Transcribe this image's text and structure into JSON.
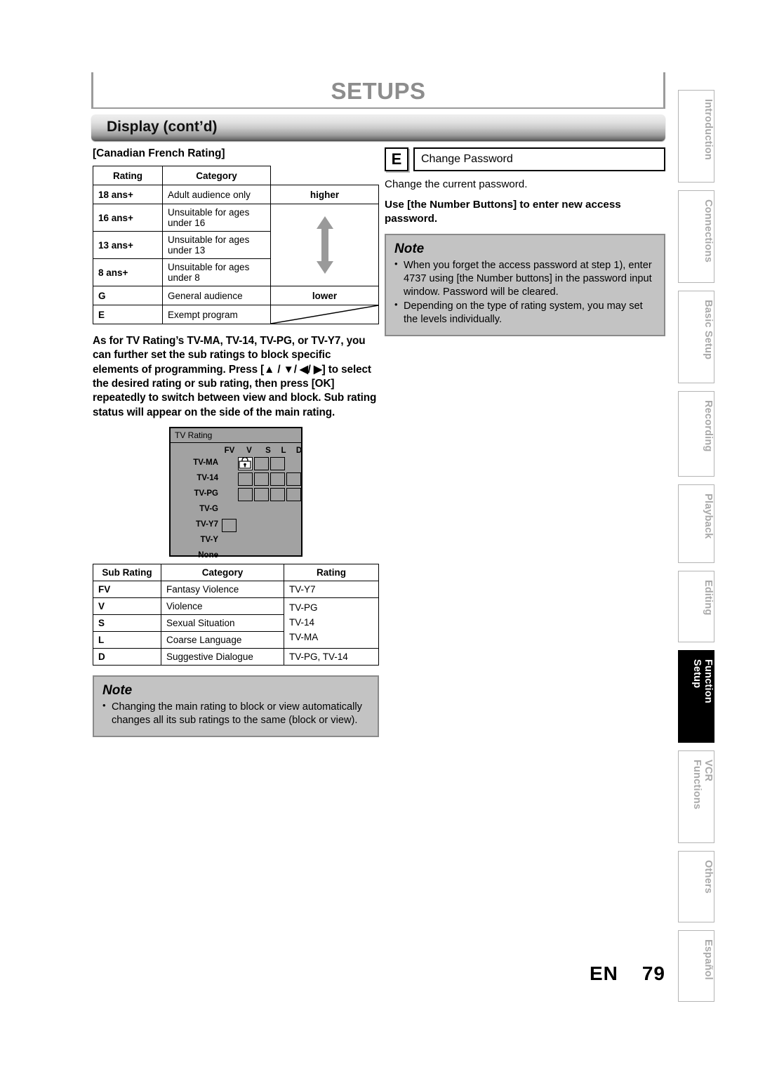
{
  "header": {
    "title": "SETUPS",
    "section_title": "Display (cont’d)"
  },
  "left": {
    "canadian_heading": "[Canadian French Rating]",
    "cf_table": {
      "columns": [
        "Rating",
        "Category"
      ],
      "rows": [
        {
          "rating": "18 ans+",
          "category": "Adult audience only"
        },
        {
          "rating": "16 ans+",
          "category": "Unsuitable for ages under 16"
        },
        {
          "rating": "13 ans+",
          "category": "Unsuitable for ages under 13"
        },
        {
          "rating": "8 ans+",
          "category": "Unsuitable for ages under 8"
        },
        {
          "rating": "G",
          "category": "General audience"
        },
        {
          "rating": "E",
          "category": "Exempt program"
        }
      ],
      "scale_top": "higher",
      "scale_bottom": "lower"
    },
    "instruction": "As for TV Rating’s TV-MA, TV-14, TV-PG, or TV-Y7, you can further set the sub ratings to block specific elements of programming. Press [▲ / ▼/ ◀/ ▶] to select the desired rating or sub rating, then press [OK] repeatedly to switch between view and block. Sub rating status will appear on the side of the main rating.",
    "osd": {
      "title": "TV Rating",
      "columns": [
        "FV",
        "V",
        "S",
        "L",
        "D"
      ],
      "rows": [
        "TV-MA",
        "TV-14",
        "TV-PG",
        "TV-G",
        "TV-Y7",
        "TV-Y",
        "None"
      ],
      "cells": [
        {
          "row": "TV-MA",
          "col": "V",
          "state": "blocked",
          "icon": "lock-icon"
        },
        {
          "row": "TV-MA",
          "col": "S",
          "state": "view"
        },
        {
          "row": "TV-MA",
          "col": "L",
          "state": "view"
        },
        {
          "row": "TV-14",
          "col": "V",
          "state": "view"
        },
        {
          "row": "TV-14",
          "col": "S",
          "state": "view"
        },
        {
          "row": "TV-14",
          "col": "L",
          "state": "view"
        },
        {
          "row": "TV-14",
          "col": "D",
          "state": "view"
        },
        {
          "row": "TV-PG",
          "col": "V",
          "state": "view"
        },
        {
          "row": "TV-PG",
          "col": "S",
          "state": "view"
        },
        {
          "row": "TV-PG",
          "col": "L",
          "state": "view"
        },
        {
          "row": "TV-PG",
          "col": "D",
          "state": "view"
        },
        {
          "row": "TV-Y7",
          "col": "FV",
          "state": "view"
        }
      ]
    },
    "sub_table": {
      "columns": [
        "Sub Rating",
        "Category",
        "Rating"
      ],
      "rows": [
        {
          "sub": "FV",
          "category": "Fantasy Violence",
          "rating": "TV-Y7"
        },
        {
          "sub": "V",
          "category": "Violence",
          "rating": ""
        },
        {
          "sub": "S",
          "category": "Sexual Situation",
          "rating": ""
        },
        {
          "sub": "L",
          "category": "Coarse Language",
          "rating": ""
        },
        {
          "sub": "D",
          "category": "Suggestive Dialogue",
          "rating": "TV-PG, TV-14"
        }
      ],
      "merged_rating_lines": [
        "TV-PG",
        "TV-14",
        "TV-MA"
      ]
    },
    "note": {
      "title": "Note",
      "items": [
        "Changing the main rating to block or view automatically changes all its sub ratings to the same (block or view)."
      ]
    }
  },
  "right": {
    "step": {
      "badge": "E",
      "field_label": "Change Password"
    },
    "line1": "Change the current password.",
    "line2": "Use [the Number Buttons] to enter new access password.",
    "note": {
      "title": "Note",
      "items": [
        "When you forget the access password at step 1), enter 4737 using [the Number buttons] in the password input window. Password will be cleared.",
        "Depending on the type of rating system, you may set the levels individually."
      ]
    }
  },
  "tabs": [
    {
      "label": "Introduction",
      "active": false
    },
    {
      "label": "Connections",
      "active": false
    },
    {
      "label": "Basic Setup",
      "active": false
    },
    {
      "label": "Recording",
      "active": false
    },
    {
      "label": "Playback",
      "active": false
    },
    {
      "label": "Editing",
      "active": false
    },
    {
      "label": "Function Setup",
      "active": true
    },
    {
      "label": "VCR Functions",
      "active": false
    },
    {
      "label": "Others",
      "active": false
    },
    {
      "label": "Español",
      "active": false
    }
  ],
  "footer": {
    "lang": "EN",
    "page": "79"
  },
  "colors": {
    "osd_bg": "#a2a2a2",
    "note_bg": "#c3c3c3",
    "title_gray": "#8d8d8d",
    "tab_gray": "#a9a9a9"
  }
}
